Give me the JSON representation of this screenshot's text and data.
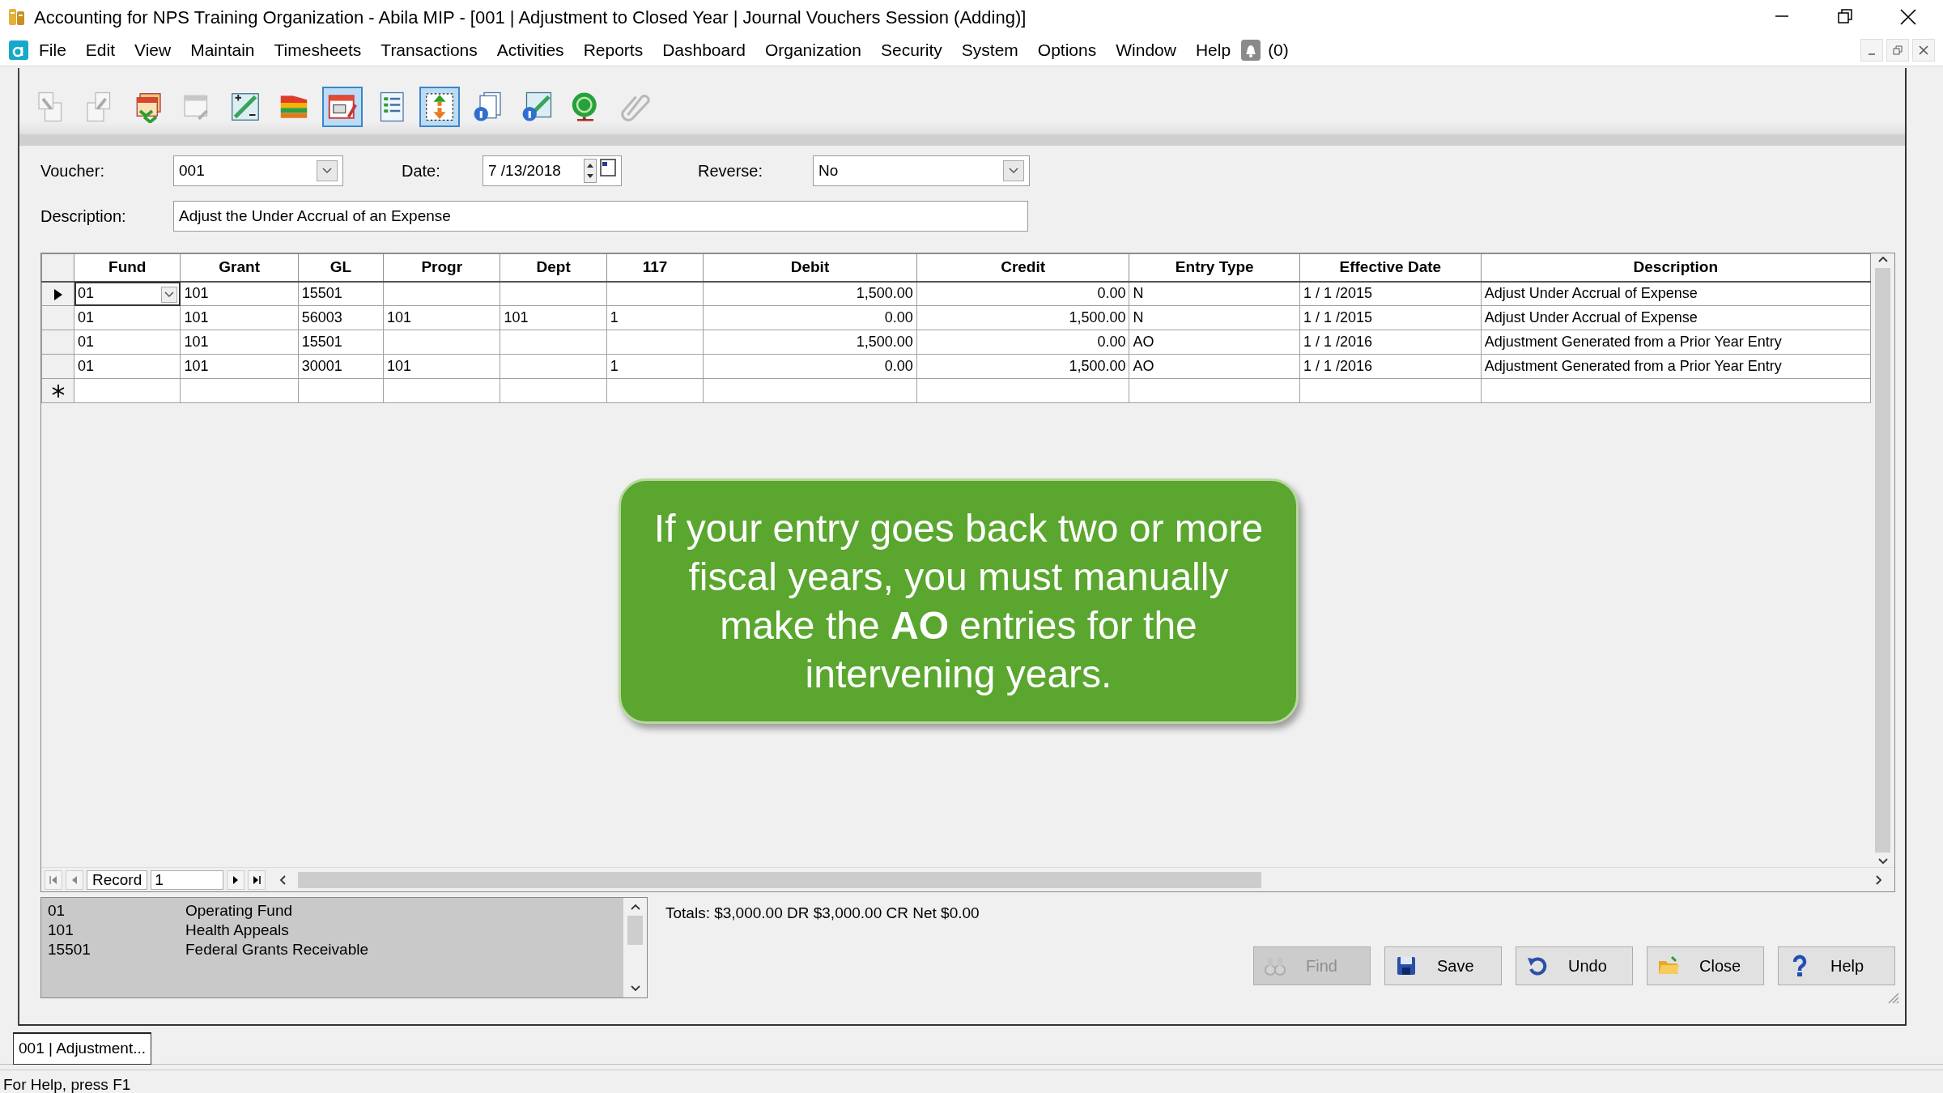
{
  "window": {
    "title": "Accounting for NPS Training Organization - Abila MIP - [001 | Adjustment to Closed Year | Journal Vouchers Session (Adding)]"
  },
  "menu": {
    "items": [
      "File",
      "Edit",
      "View",
      "Maintain",
      "Timesheets",
      "Transactions",
      "Activities",
      "Reports",
      "Dashboard",
      "Organization",
      "Security",
      "System",
      "Options",
      "Window",
      "Help"
    ],
    "notifications": "(0)"
  },
  "toolbar": [
    {
      "kind": "import",
      "disabled": true,
      "selected": false
    },
    {
      "kind": "export",
      "disabled": true,
      "selected": false
    },
    {
      "kind": "calendars",
      "disabled": false,
      "selected": false
    },
    {
      "kind": "calendar",
      "disabled": true,
      "selected": false
    },
    {
      "kind": "grid",
      "disabled": false,
      "selected": false
    },
    {
      "kind": "bars",
      "disabled": false,
      "selected": false
    },
    {
      "kind": "calendar-pen",
      "disabled": false,
      "selected": true
    },
    {
      "kind": "list",
      "disabled": false,
      "selected": false
    },
    {
      "kind": "transfer",
      "disabled": false,
      "selected": true
    },
    {
      "kind": "info-docs",
      "disabled": false,
      "selected": false
    },
    {
      "kind": "info-grid",
      "disabled": false,
      "selected": false
    },
    {
      "kind": "globe",
      "disabled": false,
      "selected": false
    },
    {
      "kind": "clip",
      "disabled": true,
      "selected": false
    }
  ],
  "form": {
    "voucher": {
      "label": "Voucher:",
      "value": "001"
    },
    "date": {
      "label": "Date:",
      "value": "7 /13/2018"
    },
    "reverse": {
      "label": "Reverse:",
      "value": "No"
    },
    "description": {
      "label": "Description:",
      "value": "Adjust the Under Accrual of an Expense"
    }
  },
  "grid": {
    "columns": [
      {
        "label": "Fund",
        "kind": "text"
      },
      {
        "label": "Grant",
        "kind": "text"
      },
      {
        "label": "GL",
        "kind": "text"
      },
      {
        "label": "Progr",
        "kind": "text"
      },
      {
        "label": "Dept",
        "kind": "text"
      },
      {
        "label": "117",
        "kind": "text"
      },
      {
        "label": "Debit",
        "kind": "amount"
      },
      {
        "label": "Credit",
        "kind": "amount"
      },
      {
        "label": "Entry Type",
        "kind": "text"
      },
      {
        "label": "Effective Date",
        "kind": "text"
      },
      {
        "label": "Description",
        "kind": "text"
      }
    ],
    "rows": [
      {
        "kind": "entry",
        "current": true,
        "cells": [
          "01",
          "101",
          "15501",
          null,
          null,
          null,
          "1,500.00",
          "0.00",
          "N",
          "1 / 1 /2015",
          "Adjust Under Accrual of Expense"
        ]
      },
      {
        "kind": "entry",
        "current": false,
        "cells": [
          "01",
          "101",
          "56003",
          "101",
          "101",
          "1",
          "0.00",
          "1,500.00",
          "N",
          "1 / 1 /2015",
          "Adjust Under Accrual of Expense"
        ]
      },
      {
        "kind": "entry",
        "current": false,
        "cells": [
          "01",
          "101",
          "15501",
          null,
          null,
          null,
          "1,500.00",
          "0.00",
          "AO",
          "1 / 1 /2016",
          "Adjustment Generated from a Prior Year Entry"
        ]
      },
      {
        "kind": "entry",
        "current": false,
        "cells": [
          "01",
          "101",
          "30001",
          "101",
          null,
          "1",
          "0.00",
          "1,500.00",
          "AO",
          "1 / 1 /2016",
          "Adjustment Generated from a Prior Year Entry"
        ]
      },
      {
        "kind": "new",
        "current": false
      }
    ]
  },
  "callout": {
    "text": "If your entry goes back two or more fiscal years, you must manually make the **AO** entries for the intervening years."
  },
  "navigator": {
    "label": "Record",
    "value": "1"
  },
  "lookup": [
    {
      "code": "01",
      "name": "Operating Fund"
    },
    {
      "code": "101",
      "name": "Health Appeals"
    },
    {
      "code": "15501",
      "name": "Federal Grants Receivable"
    }
  ],
  "totals": "Totals: $3,000.00 DR $3,000.00 CR Net $0.00",
  "buttons": [
    {
      "kind": "find",
      "label": "Find",
      "disabled": true
    },
    {
      "kind": "save",
      "label": "Save",
      "disabled": false
    },
    {
      "kind": "undo",
      "label": "Undo",
      "disabled": false
    },
    {
      "kind": "close",
      "label": "Close",
      "disabled": false
    },
    {
      "kind": "help",
      "label": "Help",
      "disabled": false
    }
  ],
  "tabs": [
    {
      "label": "001 | Adjustment...",
      "selected": true
    }
  ],
  "status_bar": "For Help, press F1"
}
